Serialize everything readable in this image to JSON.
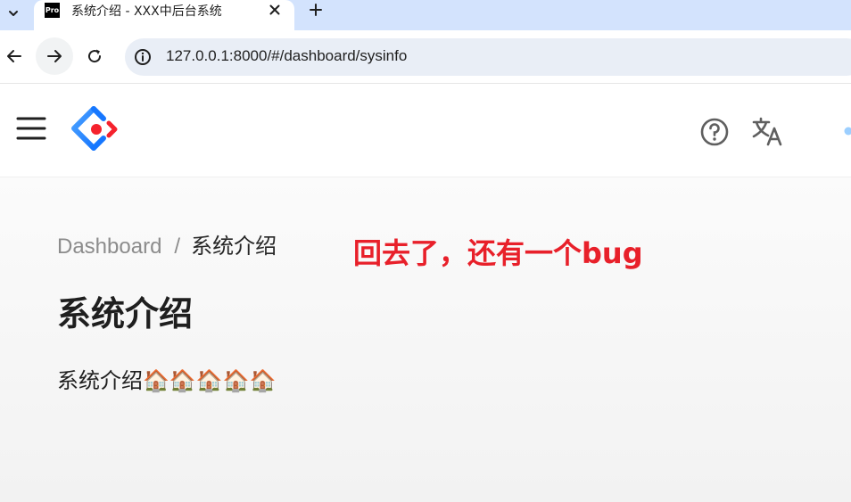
{
  "browser": {
    "tab": {
      "favicon_text": "Pro",
      "title": "系统介绍 - XXX中后台系统"
    },
    "address": {
      "url": "127.0.0.1:8000/#/dashboard/sysinfo"
    }
  },
  "header": {
    "icons": [
      "menu-icon",
      "app-logo",
      "help-icon",
      "translate-icon",
      "avatar-icon"
    ],
    "logo_colors": {
      "blue": "#1677ff",
      "red": "#f5222d"
    }
  },
  "breadcrumb": {
    "items": [
      "Dashboard",
      "系统介绍"
    ],
    "separator": "/"
  },
  "annotation": {
    "text": "回去了，还有一个bug",
    "color": "#e8202a"
  },
  "page": {
    "title": "系统介绍",
    "body": "系统介绍🏠🏠🏠🏠🏠"
  }
}
